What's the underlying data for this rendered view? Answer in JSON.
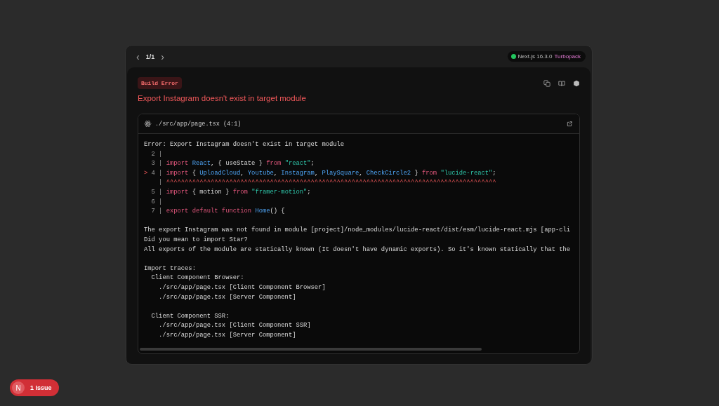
{
  "pager": {
    "prev": "‹",
    "count": "1/1",
    "next": "›"
  },
  "version_badge": {
    "version": "Next.js 16.3.0",
    "bundler": "Turbopack"
  },
  "error": {
    "label": "Build Error",
    "title": "Export Instagram doesn't exist in target module"
  },
  "source": {
    "file": "./src/app/page.tsx (4:1)",
    "lines": [
      [
        {
          "kind": "plain",
          "text": "Error: Export Instagram doesn't exist in target module"
        }
      ],
      [
        {
          "kind": "gutter",
          "text": "  2 |"
        }
      ],
      [
        {
          "kind": "gutter",
          "text": "  3 | "
        },
        {
          "kind": "keyword",
          "text": "import "
        },
        {
          "kind": "name",
          "text": "React"
        },
        {
          "kind": "plain",
          "text": ", { useState } "
        },
        {
          "kind": "keyword",
          "text": "from "
        },
        {
          "kind": "string",
          "text": "\"react\""
        },
        {
          "kind": "plain",
          "text": ";"
        }
      ],
      [
        {
          "kind": "marker",
          "text": "> "
        },
        {
          "kind": "gutter",
          "text": "4 | "
        },
        {
          "kind": "keyword",
          "text": "import "
        },
        {
          "kind": "plain",
          "text": "{ "
        },
        {
          "kind": "name",
          "text": "UploadCloud"
        },
        {
          "kind": "plain",
          "text": ", "
        },
        {
          "kind": "name",
          "text": "Youtube"
        },
        {
          "kind": "plain",
          "text": ", "
        },
        {
          "kind": "name",
          "text": "Instagram"
        },
        {
          "kind": "plain",
          "text": ", "
        },
        {
          "kind": "name",
          "text": "PlaySquare"
        },
        {
          "kind": "plain",
          "text": ", "
        },
        {
          "kind": "name",
          "text": "CheckCircle2"
        },
        {
          "kind": "plain",
          "text": " } "
        },
        {
          "kind": "keyword",
          "text": "from "
        },
        {
          "kind": "string",
          "text": "\"lucide-react\""
        },
        {
          "kind": "plain",
          "text": ";"
        }
      ],
      [
        {
          "kind": "gutter",
          "text": "    | "
        },
        {
          "kind": "marker",
          "text": "^^^^^^^^^^^^^^^^^^^^^^^^^^^^^^^^^^^^^^^^^^^^^^^^^^^^^^^^^^^^^^^^^^^^^^^^^^^^^^^^^^^^^^^^^"
        }
      ],
      [
        {
          "kind": "gutter",
          "text": "  5 | "
        },
        {
          "kind": "keyword",
          "text": "import "
        },
        {
          "kind": "plain",
          "text": "{ motion } "
        },
        {
          "kind": "keyword",
          "text": "from "
        },
        {
          "kind": "string",
          "text": "\"framer-motion\""
        },
        {
          "kind": "plain",
          "text": ";"
        }
      ],
      [
        {
          "kind": "gutter",
          "text": "  6 |"
        }
      ],
      [
        {
          "kind": "gutter",
          "text": "  7 | "
        },
        {
          "kind": "keyword",
          "text": "export default function "
        },
        {
          "kind": "name",
          "text": "Home"
        },
        {
          "kind": "plain",
          "text": "() {"
        }
      ],
      [
        {
          "kind": "blank"
        },
        {
          "kind": "plain",
          "text": "The export Instagram was not found in module [project]/node_modules/lucide-react/dist/esm/lucide-react.mjs [app-cli"
        }
      ],
      [
        {
          "kind": "plain",
          "text": "Did you mean to import Star?"
        }
      ],
      [
        {
          "kind": "plain",
          "text": "All exports of the module are statically known (It doesn't have dynamic exports). So it's known statically that the"
        }
      ],
      [
        {
          "kind": "blank"
        },
        {
          "kind": "plain",
          "text": "Import traces:"
        }
      ],
      [
        {
          "kind": "plain",
          "text": "  Client Component Browser:"
        }
      ],
      [
        {
          "kind": "plain",
          "text": "    ./src/app/page.tsx [Client Component Browser]"
        }
      ],
      [
        {
          "kind": "plain",
          "text": "    ./src/app/page.tsx [Server Component]"
        }
      ],
      [
        {
          "kind": "blank"
        },
        {
          "kind": "plain",
          "text": "  Client Component SSR:"
        }
      ],
      [
        {
          "kind": "plain",
          "text": "    ./src/app/page.tsx [Client Component SSR]"
        }
      ],
      [
        {
          "kind": "plain",
          "text": "    ./src/app/page.tsx [Server Component]"
        }
      ]
    ]
  },
  "issues_badge": {
    "logo": "N",
    "label": "1 Issue"
  }
}
